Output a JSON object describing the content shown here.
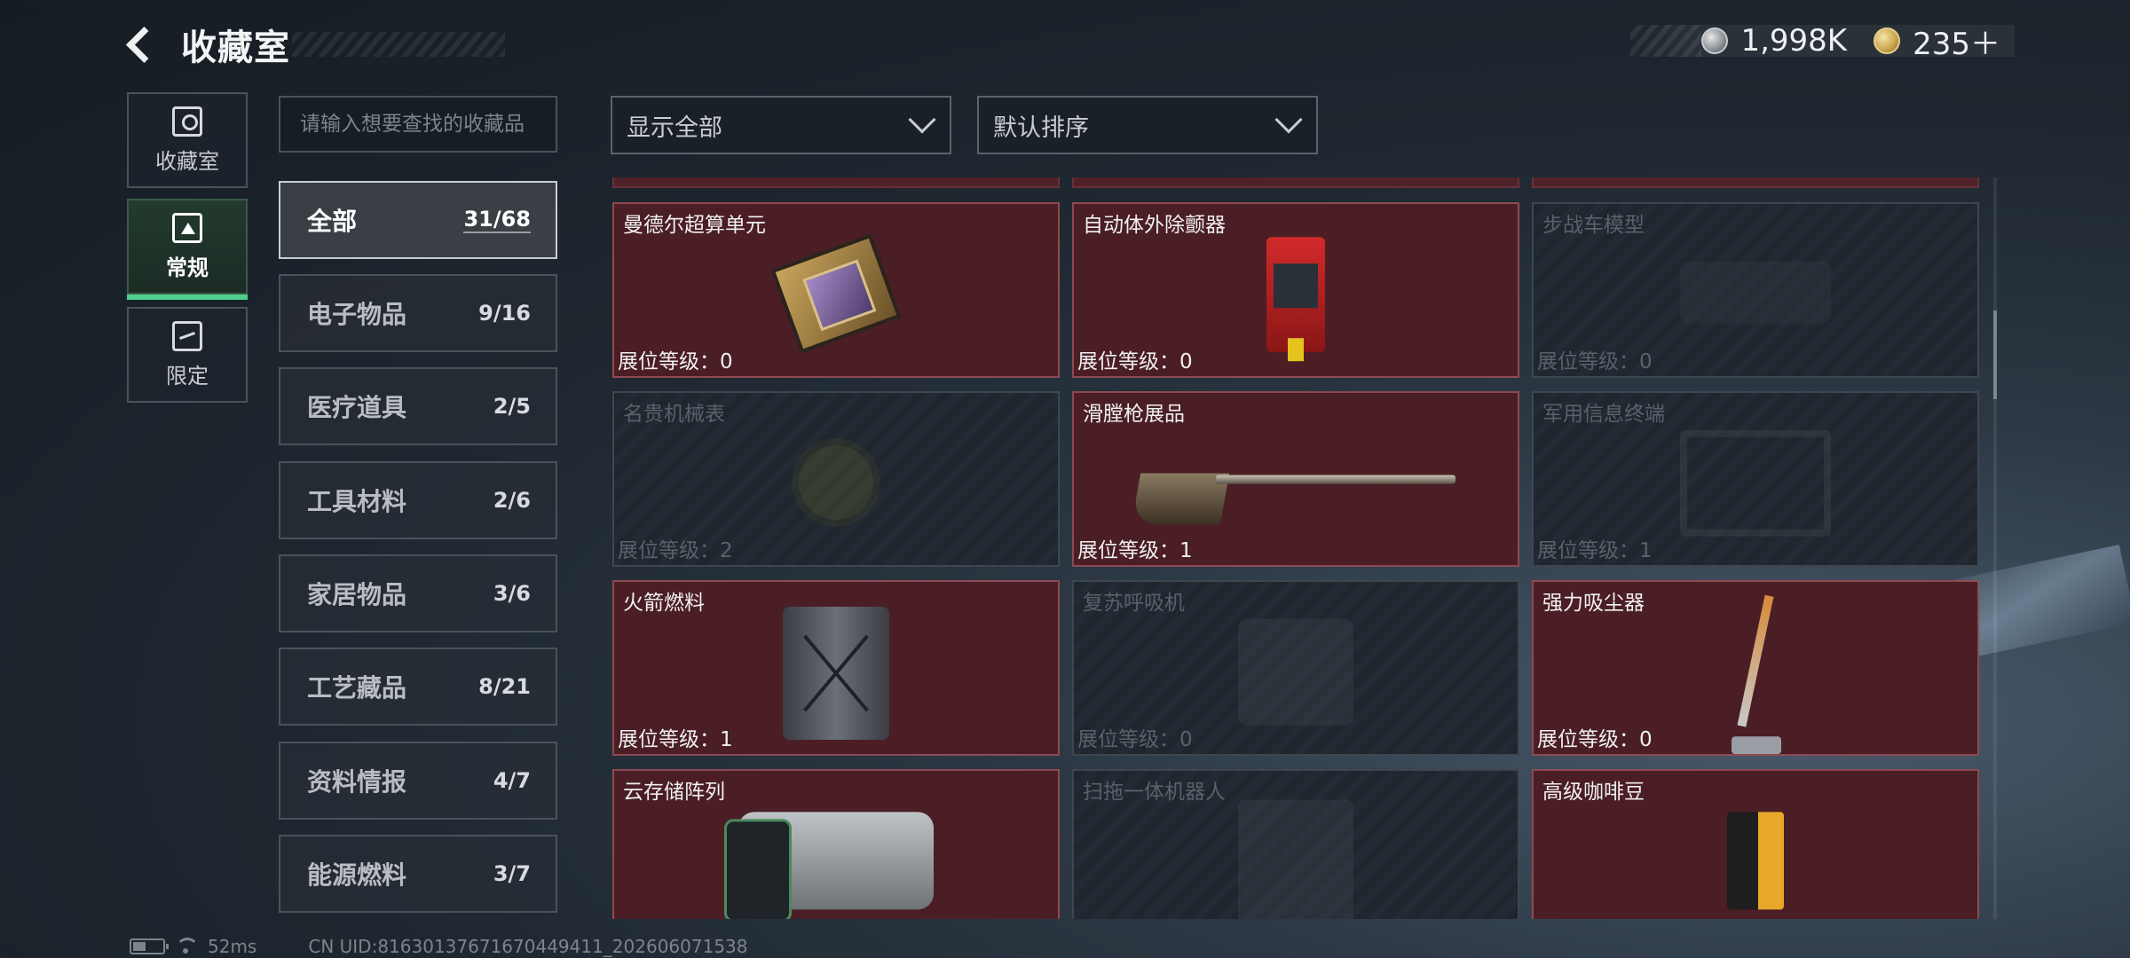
{
  "header": {
    "title": "收藏室"
  },
  "currency": [
    {
      "icon": "silver-coin-icon",
      "value": "1,998K"
    },
    {
      "icon": "gold-coin-icon",
      "value": "235＋"
    }
  ],
  "rail": [
    {
      "label": "收藏室",
      "icon": "trophy-icon",
      "active": false
    },
    {
      "label": "常规",
      "icon": "document-icon",
      "active": true
    },
    {
      "label": "限定",
      "icon": "limited-icon",
      "active": false
    }
  ],
  "search": {
    "placeholder": "请输入想要查找的收藏品"
  },
  "categories": [
    {
      "name": "全部",
      "count": "31/68",
      "active": true
    },
    {
      "name": "电子物品",
      "count": "9/16"
    },
    {
      "name": "医疗道具",
      "count": "2/5"
    },
    {
      "name": "工具材料",
      "count": "2/6"
    },
    {
      "name": "家居物品",
      "count": "3/6"
    },
    {
      "name": "工艺藏品",
      "count": "8/21"
    },
    {
      "name": "资料情报",
      "count": "4/7"
    },
    {
      "name": "能源燃料",
      "count": "3/7"
    }
  ],
  "filters": {
    "show": "显示全部",
    "sort": "默认排序"
  },
  "items": [
    {
      "name": "曼德尔超算单元",
      "level": "展位等级：0",
      "locked": false,
      "icon": "supercomputer-chip-icon"
    },
    {
      "name": "自动体外除颤器",
      "level": "展位等级：0",
      "locked": false,
      "icon": "defibrillator-icon"
    },
    {
      "name": "步战车模型",
      "level": "展位等级：0",
      "locked": true,
      "icon": "ifv-model-icon"
    },
    {
      "name": "名贵机械表",
      "level": "展位等级：2",
      "locked": true,
      "icon": "watch-icon"
    },
    {
      "name": "滑膛枪展品",
      "level": "展位等级：1",
      "locked": false,
      "icon": "musket-icon"
    },
    {
      "name": "军用信息终端",
      "level": "展位等级：1",
      "locked": true,
      "icon": "laptop-icon"
    },
    {
      "name": "火箭燃料",
      "level": "展位等级：1",
      "locked": false,
      "icon": "jerrycan-icon"
    },
    {
      "name": "复苏呼吸机",
      "level": "展位等级：0",
      "locked": true,
      "icon": "ventilator-icon"
    },
    {
      "name": "强力吸尘器",
      "level": "展位等级：0",
      "locked": false,
      "icon": "vacuum-icon"
    },
    {
      "name": "云存储阵列",
      "level": "",
      "locked": false,
      "icon": "server-array-icon"
    },
    {
      "name": "扫拖一体机器人",
      "level": "",
      "locked": true,
      "icon": "robot-icon"
    },
    {
      "name": "高级咖啡豆",
      "level": "",
      "locked": false,
      "icon": "coffee-bag-icon"
    }
  ],
  "status": {
    "ping": "52ms",
    "uid": "CN UID:81630137671670449411_202606071538"
  },
  "colors": {
    "accent": "#4fd08c",
    "unlocked_card": "#4a1e24",
    "locked_card": "#1f262e"
  }
}
